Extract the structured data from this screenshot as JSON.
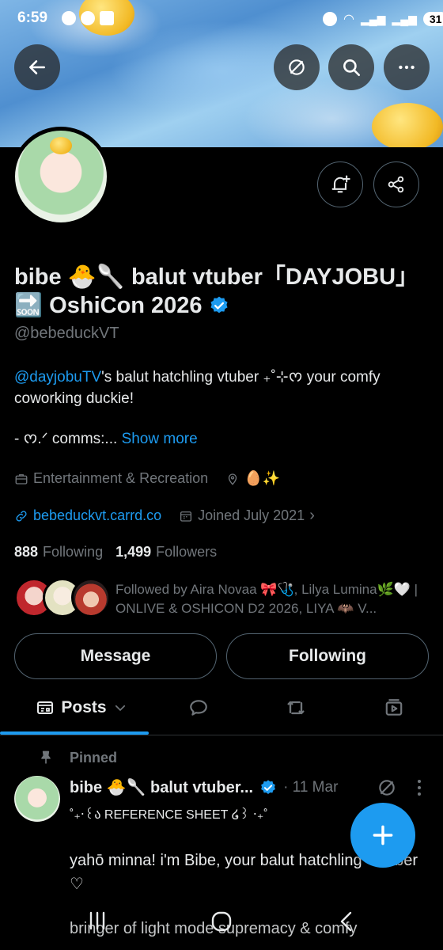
{
  "status_bar": {
    "time": "6:59",
    "battery": "31"
  },
  "profile": {
    "name_line1": "bibe 🐣🥄 balut vtuber「DAYJOBU」",
    "name_line2": "🔜 OshiCon 2026",
    "handle": "@bebeduckVT",
    "bio_mention": "@dayjobuTV",
    "bio_rest": "'s balut hatchling vtuber ₊˚⊹ᰔ your comfy coworking duckie!",
    "bio_line2": "- ᰔ.ᐟ comms:...",
    "show_more": "Show more",
    "category": "Entertainment & Recreation",
    "location": "🥚✨",
    "website": "bebeduckvt.carrd.co",
    "joined": "Joined July 2021",
    "following_count": "888",
    "following_label": "Following",
    "followers_count": "1,499",
    "followers_label": "Followers",
    "followed_by": "Followed by Aira Novaa 🎀🩺, Lilya Lumina🌿🤍 | ONLIVE & OSHICON D2 2026, LIYA 🦇 V..."
  },
  "actions": {
    "message": "Message",
    "following": "Following"
  },
  "tabs": {
    "posts": "Posts"
  },
  "pinned_post": {
    "pinned_label": "Pinned",
    "author": "bibe 🐣🥄 balut vtuber...",
    "date": "· 11 Mar",
    "line1": "˚₊‧꒰ა REFERENCE SHEET ໒꒱ ‧₊˚",
    "line2": "yahō minna! i'm Bibe, your balut hatchling VTuber ♡",
    "line3": "bringer of light mode supremacy & comfy"
  },
  "colors": {
    "accent": "#1d9bf0",
    "verified": "#1d9bf0",
    "muted": "#71767b",
    "border": "#536471"
  }
}
